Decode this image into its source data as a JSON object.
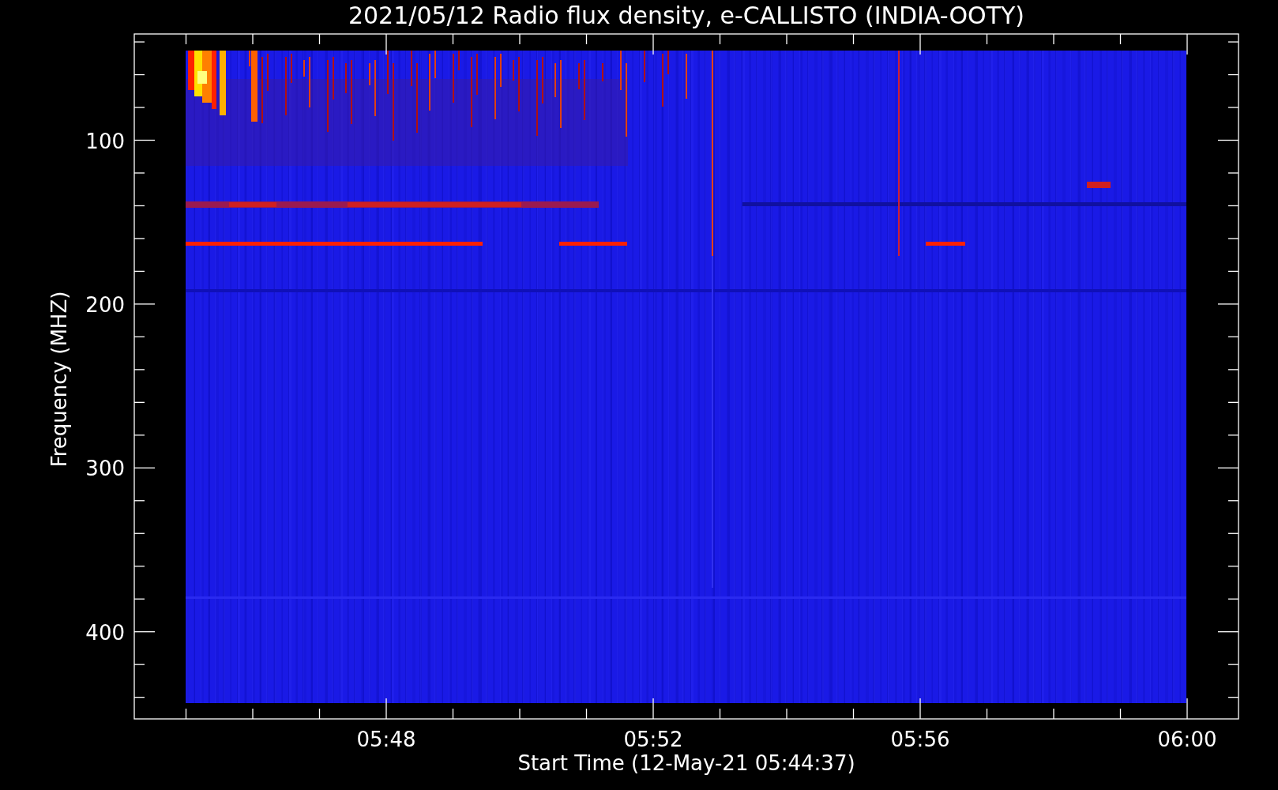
{
  "title": "2021/05/12  Radio flux density, e-CALLISTO (INDIA-OOTY)",
  "y_axis": {
    "label": "Frequency (MHZ)",
    "tick_labels": [
      "100",
      "200",
      "300",
      "400"
    ]
  },
  "x_axis": {
    "label": "Start Time (12-May-21 05:44:37)",
    "tick_labels": [
      "05:48",
      "05:52",
      "05:56",
      "06:00"
    ]
  }
}
